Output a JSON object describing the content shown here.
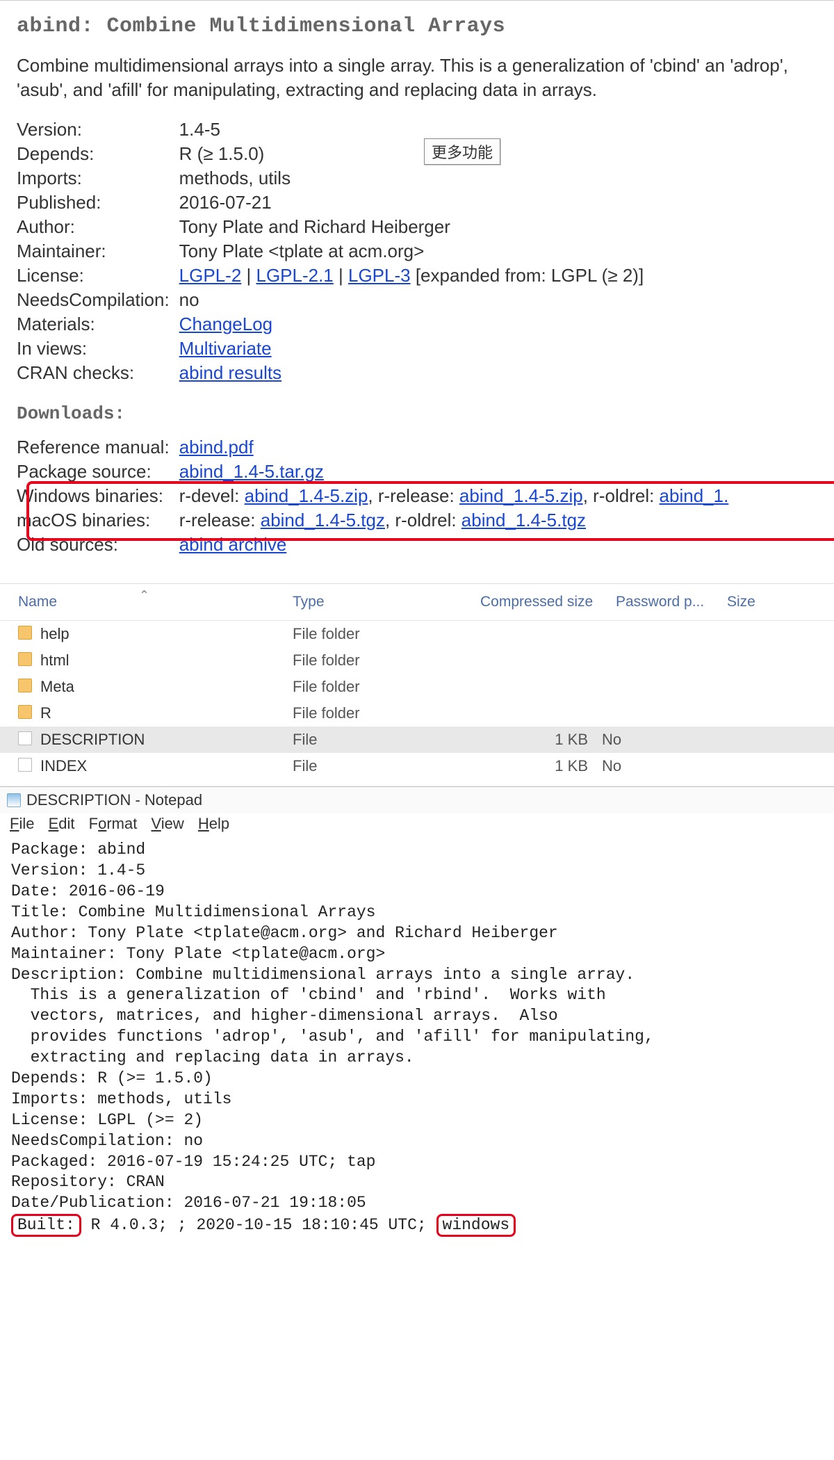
{
  "header": {
    "title": "abind: Combine Multidimensional Arrays",
    "summary": "Combine multidimensional arrays into a single array. This is a generalization of 'cbind' an 'adrop', 'asub', and 'afill' for manipulating, extracting and replacing data in arrays.",
    "tooltip": "更多功能"
  },
  "meta": {
    "version_k": "Version:",
    "version_v": "1.4-5",
    "depends_k": "Depends:",
    "depends_v": "R (≥ 1.5.0)",
    "imports_k": "Imports:",
    "imports_v": "methods, utils",
    "published_k": "Published:",
    "published_v": "2016-07-21",
    "author_k": "Author:",
    "author_v": "Tony Plate and Richard Heiberger",
    "maint_k": "Maintainer:",
    "maint_v": "Tony Plate <tplate at acm.org>",
    "license_k": "License:",
    "license_l1": "LGPL-2",
    "license_sep": " | ",
    "license_l2": "LGPL-2.1",
    "license_l3": "LGPL-3",
    "license_tail": " [expanded from: LGPL (≥ 2)]",
    "needsc_k": "NeedsCompilation:",
    "needsc_v": "no",
    "materials_k": "Materials:",
    "materials_link": "ChangeLog",
    "inviews_k": "In views:",
    "inviews_link": "Multivariate",
    "checks_k": "CRAN checks:",
    "checks_link": "abind results"
  },
  "downloads": {
    "heading": "Downloads:",
    "refman_k": "Reference manual:",
    "refman_link": "abind.pdf",
    "src_k": "Package source:",
    "src_link": "abind_1.4-5.tar.gz",
    "win_k": "Windows binaries:",
    "win_devel_pre": "r-devel: ",
    "win_devel_link": "abind_1.4-5.zip",
    "win_rel_pre": ", r-release: ",
    "win_rel_link": "abind_1.4-5.zip",
    "win_old_pre": ", r-oldrel: ",
    "win_old_link": "abind_1.",
    "mac_k": "macOS binaries:",
    "mac_rel_pre": "r-release: ",
    "mac_rel_link": "abind_1.4-5.tgz",
    "mac_old_pre": ", r-oldrel: ",
    "mac_old_link": "abind_1.4-5.tgz",
    "old_k": "Old sources:",
    "old_link": "abind archive"
  },
  "explorer": {
    "cols": {
      "name": "Name",
      "type": "Type",
      "csize": "Compressed size",
      "pw": "Password p...",
      "size": "Size"
    },
    "rows": [
      {
        "name": "help",
        "type": "File folder",
        "csize": "",
        "pw": "",
        "kind": "folder"
      },
      {
        "name": "html",
        "type": "File folder",
        "csize": "",
        "pw": "",
        "kind": "folder"
      },
      {
        "name": "Meta",
        "type": "File folder",
        "csize": "",
        "pw": "",
        "kind": "folder"
      },
      {
        "name": "R",
        "type": "File folder",
        "csize": "",
        "pw": "",
        "kind": "folder"
      },
      {
        "name": "DESCRIPTION",
        "type": "File",
        "csize": "1 KB",
        "pw": "No",
        "kind": "file",
        "selected": true
      },
      {
        "name": "INDEX",
        "type": "File",
        "csize": "1 KB",
        "pw": "No",
        "kind": "file"
      }
    ]
  },
  "notepad": {
    "title": "DESCRIPTION - Notepad",
    "menus": {
      "file": "File",
      "edit": "Edit",
      "format": "Format",
      "view": "View",
      "help": "Help"
    },
    "body_pre": "Package: abind\nVersion: 1.4-5\nDate: 2016-06-19\nTitle: Combine Multidimensional Arrays\nAuthor: Tony Plate <tplate@acm.org> and Richard Heiberger\nMaintainer: Tony Plate <tplate@acm.org>\nDescription: Combine multidimensional arrays into a single array.\n  This is a generalization of 'cbind' and 'rbind'.  Works with\n  vectors, matrices, and higher-dimensional arrays.  Also\n  provides functions 'adrop', 'asub', and 'afill' for manipulating,\n  extracting and replacing data in arrays.\nDepends: R (>= 1.5.0)\nImports: methods, utils\nLicense: LGPL (>= 2)\nNeedsCompilation: no\nPackaged: 2016-07-19 15:24:25 UTC; tap\nRepository: CRAN\nDate/Publication: 2016-07-21 19:18:05\n",
    "built_label": "Built:",
    "built_mid": " R 4.0.3; ; 2020-10-15 18:10:45 UTC; ",
    "built_os": "windows"
  }
}
